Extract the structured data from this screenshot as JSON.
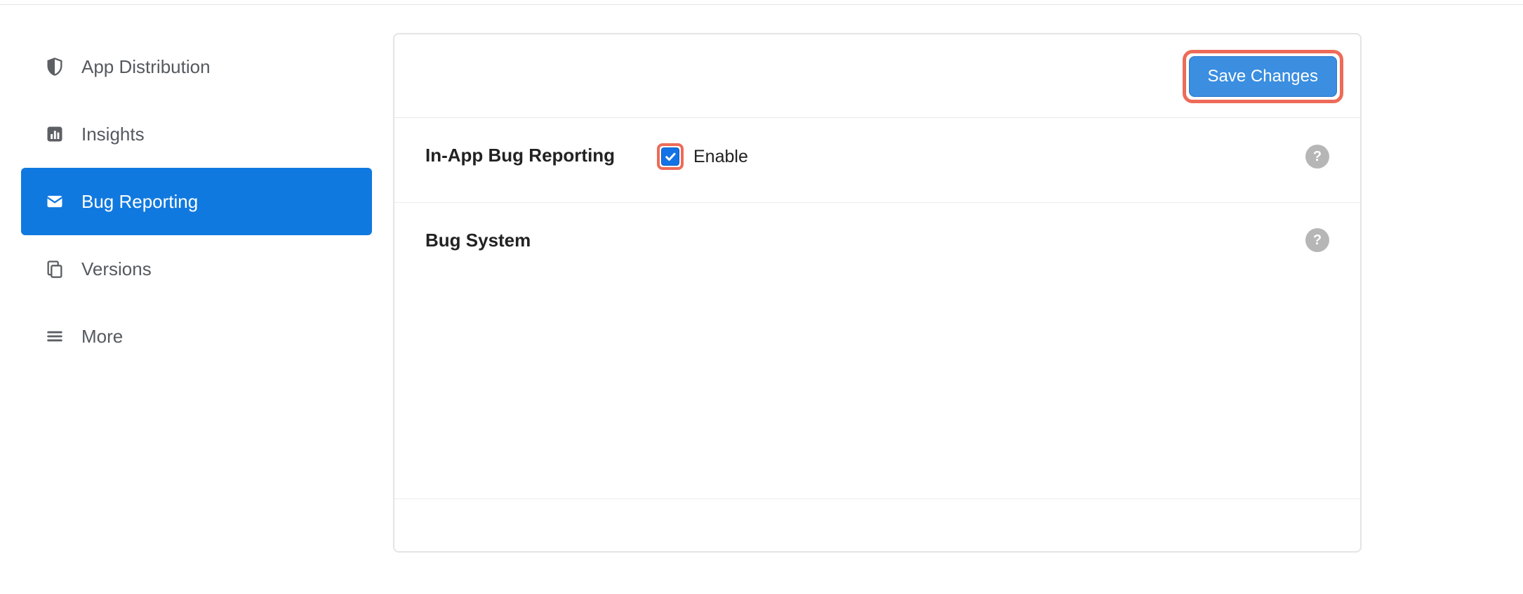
{
  "sidebar": {
    "items": [
      {
        "label": "App Distribution"
      },
      {
        "label": "Insights"
      },
      {
        "label": "Bug Reporting"
      },
      {
        "label": "Versions"
      },
      {
        "label": "More"
      }
    ]
  },
  "header": {
    "save_label": "Save Changes"
  },
  "sections": {
    "in_app_bug": {
      "title": "In-App Bug Reporting",
      "enable_label": "Enable",
      "enabled": true
    },
    "bug_system": {
      "title": "Bug System"
    }
  }
}
